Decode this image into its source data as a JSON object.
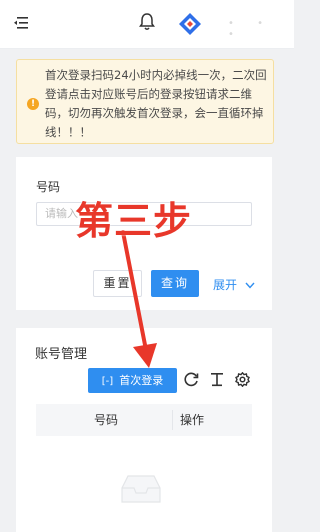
{
  "notice": {
    "text": "首次登录扫码24小时内必掉线一次，二次回登请点击对应账号后的登录按钮请求二维码，切勿再次触发首次登录，会一直循环掉线！！！"
  },
  "search": {
    "label": "号码",
    "placeholder": "请输入",
    "reset_label": "重置",
    "query_label": "查询",
    "expand_label": "展开"
  },
  "accounts": {
    "title": "账号管理",
    "first_login_label": "首次登录",
    "columns": [
      "号码",
      "操作"
    ]
  },
  "annotation": {
    "text": "第三步"
  },
  "colors": {
    "primary": "#2f8ef0",
    "annotation": "#e8372a",
    "notice_bg": "#fdf6e3",
    "notice_icon": "#f5a623"
  }
}
